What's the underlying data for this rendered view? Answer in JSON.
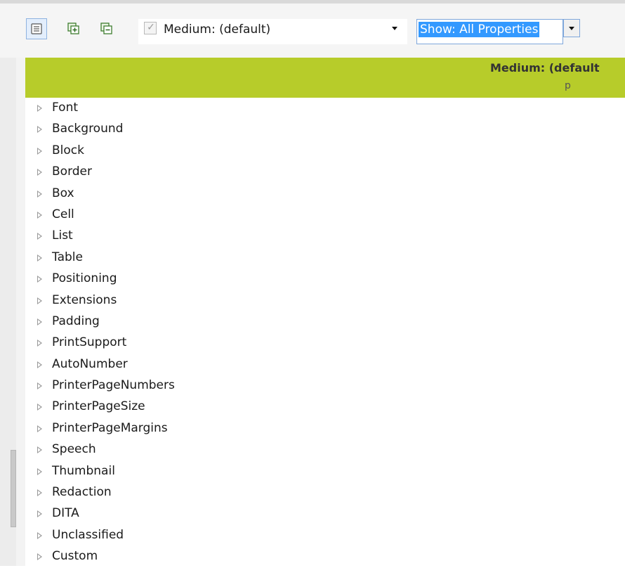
{
  "toolbar": {
    "buttons": [
      {
        "icon": "list-view-icon",
        "active": true
      },
      {
        "icon": "expand-all-icon",
        "active": false
      },
      {
        "icon": "collapse-all-icon",
        "active": false
      }
    ],
    "medium_select": {
      "value": "Medium: (default)",
      "checked": true
    },
    "show_select": {
      "value": "Show: All Properties"
    }
  },
  "header": {
    "title": "Medium: (default",
    "subtitle": "p",
    "color": "#b7cc2a"
  },
  "tree": {
    "items": [
      {
        "label": "Font"
      },
      {
        "label": "Background"
      },
      {
        "label": "Block"
      },
      {
        "label": "Border"
      },
      {
        "label": "Box"
      },
      {
        "label": "Cell"
      },
      {
        "label": "List"
      },
      {
        "label": "Table"
      },
      {
        "label": "Positioning"
      },
      {
        "label": "Extensions"
      },
      {
        "label": "Padding"
      },
      {
        "label": "PrintSupport"
      },
      {
        "label": "AutoNumber"
      },
      {
        "label": "PrinterPageNumbers"
      },
      {
        "label": "PrinterPageSize"
      },
      {
        "label": "PrinterPageMargins"
      },
      {
        "label": "Speech"
      },
      {
        "label": "Thumbnail"
      },
      {
        "label": "Redaction"
      },
      {
        "label": "DITA"
      },
      {
        "label": "Unclassified"
      },
      {
        "label": "Custom"
      }
    ]
  }
}
